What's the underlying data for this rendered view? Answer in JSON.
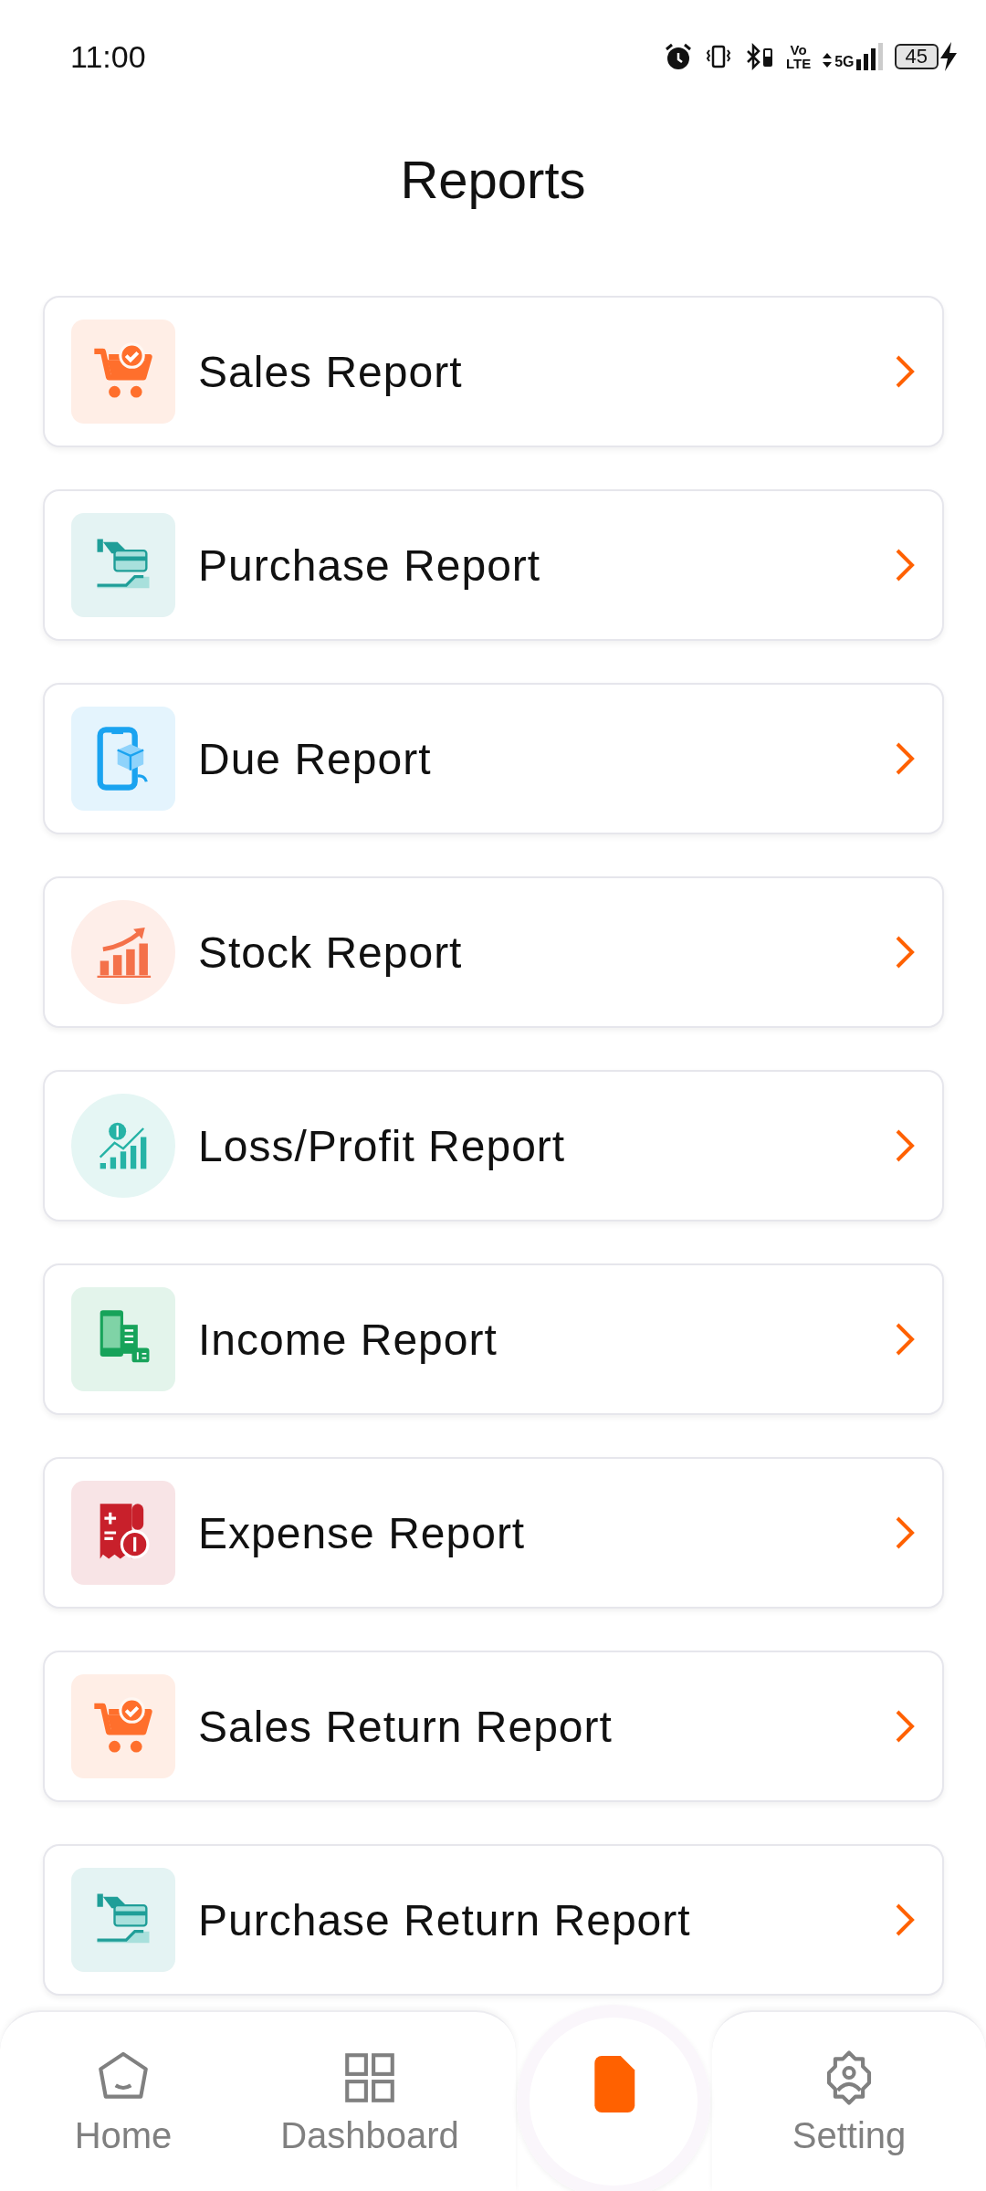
{
  "status_bar": {
    "time": "11:00",
    "volte_top": "Vo",
    "volte_bottom": "LTE",
    "network": "5G",
    "battery": "45"
  },
  "header": {
    "title": "Reports"
  },
  "reports": [
    {
      "label": "Sales Report",
      "kind": "cart",
      "color": "#ff6f2c"
    },
    {
      "label": "Purchase Report",
      "kind": "card",
      "color": "#1f9e98"
    },
    {
      "label": "Due Report",
      "kind": "phone",
      "color": "#1aa3f0"
    },
    {
      "label": "Stock Report",
      "kind": "stock",
      "color": "#f4714a"
    },
    {
      "label": "Loss/Profit Report",
      "kind": "profit",
      "color": "#26b3a6"
    },
    {
      "label": "Income Report",
      "kind": "income",
      "color": "#17a35a"
    },
    {
      "label": "Expense Report",
      "kind": "expense",
      "color": "#c8202b"
    },
    {
      "label": "Sales Return Report",
      "kind": "cart",
      "color": "#ff6f2c"
    },
    {
      "label": "Purchase Return Report",
      "kind": "card",
      "color": "#1f9e98"
    }
  ],
  "nav": [
    {
      "label": "Home",
      "kind": "home"
    },
    {
      "label": "Dashboard",
      "kind": "grid"
    },
    {
      "kind": "center"
    },
    {
      "label": "Setting",
      "kind": "gear"
    }
  ]
}
